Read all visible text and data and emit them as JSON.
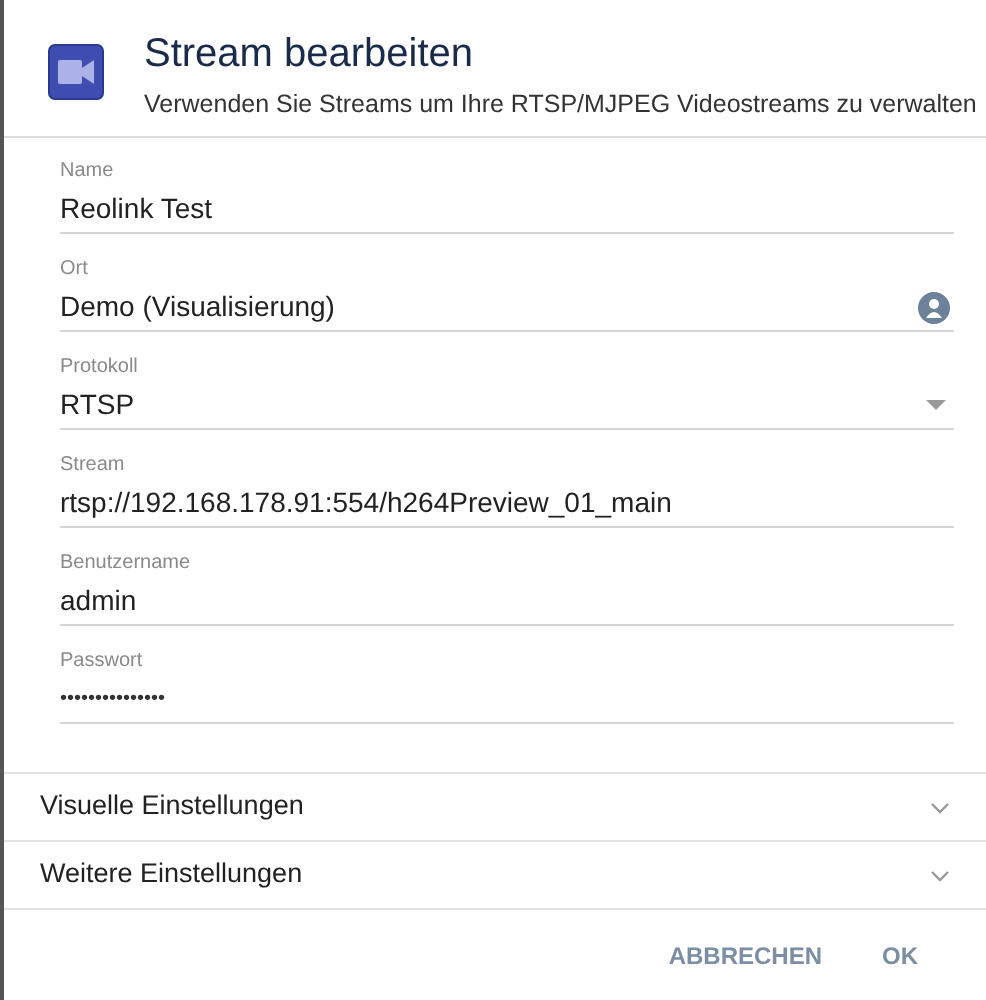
{
  "dialog": {
    "title": "Stream bearbeiten",
    "subtitle": "Verwenden Sie Streams um Ihre RTSP/MJPEG Videostreams zu verwalten"
  },
  "fields": [
    {
      "kind": "text",
      "label": "Name",
      "value": "Reolink Test"
    },
    {
      "kind": "location",
      "label": "Ort",
      "value": "Demo (Visualisierung)"
    },
    {
      "kind": "select",
      "label": "Protokoll",
      "value": "RTSP"
    },
    {
      "kind": "text",
      "label": "Stream",
      "value": "rtsp://192.168.178.91:554/h264Preview_01_main"
    },
    {
      "kind": "text",
      "label": "Benutzername",
      "value": "admin"
    },
    {
      "kind": "password",
      "label": "Passwort",
      "value": "•••••••••••••••"
    }
  ],
  "sections": [
    {
      "title": "Visuelle Einstellungen",
      "expanded": false
    },
    {
      "title": "Weitere Einstellungen",
      "expanded": false
    }
  ],
  "buttons": [
    "ABBRECHEN",
    "OK"
  ]
}
